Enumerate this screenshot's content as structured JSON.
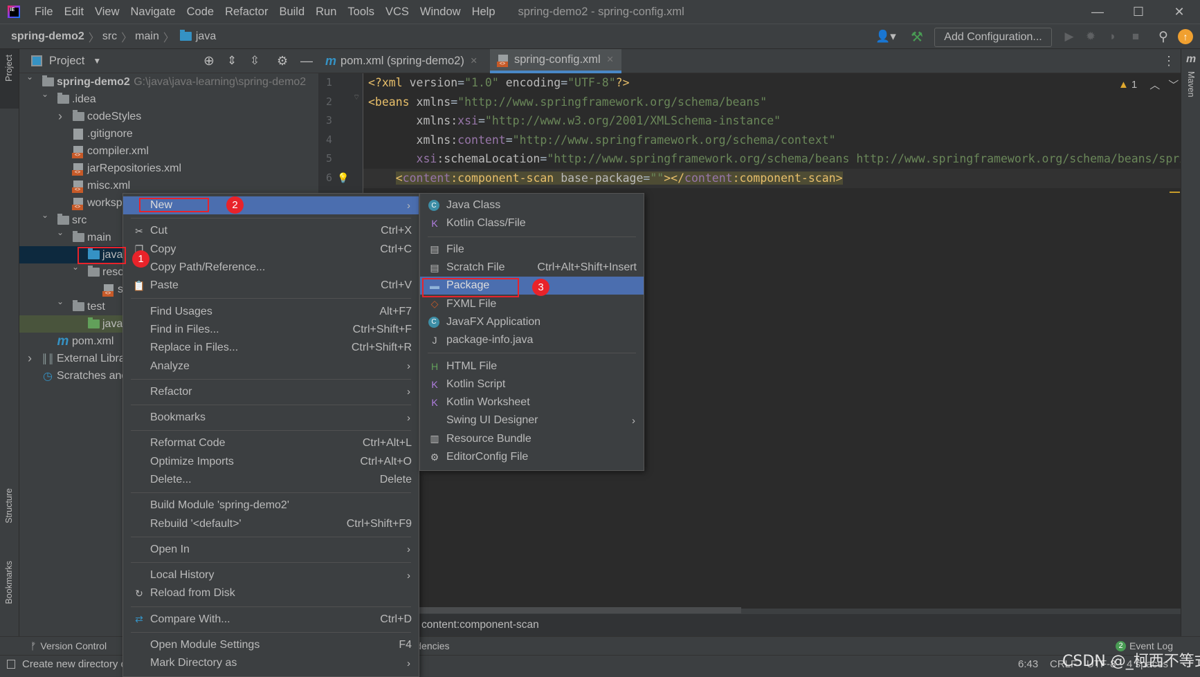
{
  "title_bar": {
    "menu": [
      "File",
      "Edit",
      "View",
      "Navigate",
      "Code",
      "Refactor",
      "Build",
      "Run",
      "Tools",
      "VCS",
      "Window",
      "Help"
    ],
    "window_title": "spring-demo2 - spring-config.xml"
  },
  "navbar": {
    "breadcrumb": [
      "spring-demo2",
      "src",
      "main",
      "java"
    ],
    "add_configuration": "Add Configuration..."
  },
  "side_strips": {
    "left_top": "Project",
    "left_structure": "Structure",
    "left_bookmarks": "Bookmarks",
    "right_maven": "Maven"
  },
  "project_panel": {
    "title": "Project",
    "tree": [
      {
        "label": "spring-demo2",
        "hint": "G:\\java\\java-learning\\spring-demo2",
        "depth": 0,
        "state": "expanded",
        "icon": "module-folder",
        "bold": true
      },
      {
        "label": ".idea",
        "depth": 1,
        "state": "expanded",
        "icon": "folder"
      },
      {
        "label": "codeStyles",
        "depth": 2,
        "state": "collapsed",
        "icon": "folder"
      },
      {
        "label": ".gitignore",
        "depth": 2,
        "icon": "ignore-file"
      },
      {
        "label": "compiler.xml",
        "depth": 2,
        "icon": "xml-file"
      },
      {
        "label": "jarRepositories.xml",
        "depth": 2,
        "icon": "xml-file"
      },
      {
        "label": "misc.xml",
        "depth": 2,
        "icon": "xml-file"
      },
      {
        "label": "workspace.xml",
        "depth": 2,
        "icon": "xml-file"
      },
      {
        "label": "src",
        "depth": 1,
        "state": "expanded",
        "icon": "folder"
      },
      {
        "label": "main",
        "depth": 2,
        "state": "expanded",
        "icon": "folder"
      },
      {
        "label": "java",
        "depth": 3,
        "icon": "source-folder",
        "selected": true
      },
      {
        "label": "resources",
        "depth": 3,
        "state": "expanded",
        "icon": "resources-folder"
      },
      {
        "label": "spring-config.xml",
        "depth": 4,
        "icon": "xml-file"
      },
      {
        "label": "test",
        "depth": 2,
        "state": "expanded",
        "icon": "folder"
      },
      {
        "label": "java",
        "depth": 3,
        "icon": "test-folder",
        "highlighted": true
      },
      {
        "label": "pom.xml",
        "depth": 1,
        "icon": "maven-file"
      },
      {
        "label": "External Libraries",
        "depth": 0,
        "state": "collapsed",
        "icon": "libraries"
      },
      {
        "label": "Scratches and Consoles",
        "depth": 0,
        "icon": "scratches"
      }
    ]
  },
  "tabs": [
    {
      "label": "pom.xml (spring-demo2)",
      "icon": "maven-icon",
      "active": false
    },
    {
      "label": "spring-config.xml",
      "icon": "xml-file-icon",
      "active": true
    }
  ],
  "editor": {
    "warnings": "1",
    "lines": [
      {
        "n": "1",
        "seg": [
          [
            "<?xml ",
            "tag"
          ],
          [
            "version",
            "attr"
          ],
          [
            "=",
            "txt"
          ],
          [
            "\"1.0\" ",
            "str"
          ],
          [
            "encoding",
            "attr"
          ],
          [
            "=",
            "txt"
          ],
          [
            "\"UTF-8\"",
            "str"
          ],
          [
            "?>",
            "tag"
          ]
        ]
      },
      {
        "n": "2",
        "seg": [
          [
            "<beans ",
            "tag"
          ],
          [
            "xmlns",
            "attr"
          ],
          [
            "=",
            "txt"
          ],
          [
            "\"http://www.springframework.org/schema/beans\"",
            "str"
          ]
        ]
      },
      {
        "n": "3",
        "seg": [
          [
            "       ",
            "txt"
          ],
          [
            "xmlns",
            "attr"
          ],
          [
            ":",
            "attr"
          ],
          [
            "xsi",
            "ns"
          ],
          [
            "=",
            "txt"
          ],
          [
            "\"http://www.w3.org/2001/XMLSchema-instance\"",
            "str"
          ]
        ]
      },
      {
        "n": "4",
        "seg": [
          [
            "       ",
            "txt"
          ],
          [
            "xmlns",
            "attr"
          ],
          [
            ":",
            "attr"
          ],
          [
            "content",
            "ns"
          ],
          [
            "=",
            "txt"
          ],
          [
            "\"http://www.springframework.org/schema/context\"",
            "str"
          ]
        ]
      },
      {
        "n": "5",
        "seg": [
          [
            "       ",
            "txt"
          ],
          [
            "xsi",
            "ns"
          ],
          [
            ":schemaLocation",
            "attr"
          ],
          [
            "=",
            "txt"
          ],
          [
            "\"http://www.springframework.org/schema/beans http://www.springframework.org/schema/beans/spring-beans.xsd\"",
            "str"
          ]
        ]
      },
      {
        "n": "6",
        "seg": [
          [
            "    ",
            "txt"
          ],
          [
            "<",
            "tag hl"
          ],
          [
            "content",
            "ns hl"
          ],
          [
            ":component-scan ",
            "tag hl"
          ],
          [
            "base-package",
            "attr hl"
          ],
          [
            "=",
            "txt hl"
          ],
          [
            "\"\"",
            "str hl"
          ],
          [
            "></",
            "tag hl"
          ],
          [
            "content",
            "ns hl"
          ],
          [
            ":component-scan>",
            "tag hl"
          ]
        ]
      }
    ],
    "breadcrumb": "content:component-scan"
  },
  "context_menu": [
    {
      "label": "New",
      "submenu": true,
      "selected": true
    },
    {
      "sep": true
    },
    {
      "label": "Cut",
      "shortcut": "Ctrl+X",
      "icon": "scissors"
    },
    {
      "label": "Copy",
      "shortcut": "Ctrl+C",
      "icon": "copy"
    },
    {
      "label": "Copy Path/Reference..."
    },
    {
      "label": "Paste",
      "shortcut": "Ctrl+V",
      "icon": "clipboard"
    },
    {
      "sep": true
    },
    {
      "label": "Find Usages",
      "shortcut": "Alt+F7"
    },
    {
      "label": "Find in Files...",
      "shortcut": "Ctrl+Shift+F"
    },
    {
      "label": "Replace in Files...",
      "shortcut": "Ctrl+Shift+R"
    },
    {
      "label": "Analyze",
      "submenu": true
    },
    {
      "sep": true
    },
    {
      "label": "Refactor",
      "submenu": true
    },
    {
      "sep": true
    },
    {
      "label": "Bookmarks",
      "submenu": true
    },
    {
      "sep": true
    },
    {
      "label": "Reformat Code",
      "shortcut": "Ctrl+Alt+L"
    },
    {
      "label": "Optimize Imports",
      "shortcut": "Ctrl+Alt+O"
    },
    {
      "label": "Delete...",
      "shortcut": "Delete"
    },
    {
      "sep": true
    },
    {
      "label": "Build Module 'spring-demo2'"
    },
    {
      "label": "Rebuild '<default>'",
      "shortcut": "Ctrl+Shift+F9"
    },
    {
      "sep": true
    },
    {
      "label": "Open In",
      "submenu": true
    },
    {
      "sep": true
    },
    {
      "label": "Local History",
      "submenu": true
    },
    {
      "label": "Reload from Disk",
      "icon": "reload"
    },
    {
      "sep": true
    },
    {
      "label": "Compare With...",
      "shortcut": "Ctrl+D",
      "icon": "compare"
    },
    {
      "sep": true
    },
    {
      "label": "Open Module Settings",
      "shortcut": "F4"
    },
    {
      "label": "Mark Directory as",
      "submenu": true
    }
  ],
  "new_submenu": [
    {
      "label": "Java Class",
      "icon": "java-class"
    },
    {
      "label": "Kotlin Class/File",
      "icon": "kotlin-file"
    },
    {
      "sep": true
    },
    {
      "label": "File",
      "icon": "file"
    },
    {
      "label": "Scratch File",
      "shortcut": "Ctrl+Alt+Shift+Insert",
      "icon": "scratch-file"
    },
    {
      "label": "Package",
      "icon": "package",
      "selected": true
    },
    {
      "label": "FXML File",
      "icon": "fxml-file"
    },
    {
      "label": "JavaFX Application",
      "icon": "java-class"
    },
    {
      "label": "package-info.java",
      "icon": "java-file"
    },
    {
      "sep": true
    },
    {
      "label": "HTML File",
      "icon": "html-file"
    },
    {
      "label": "Kotlin Script",
      "icon": "kotlin-script"
    },
    {
      "label": "Kotlin Worksheet",
      "icon": "kotlin-script"
    },
    {
      "label": "Swing UI Designer",
      "submenu": true
    },
    {
      "label": "Resource Bundle",
      "icon": "resource-bundle"
    },
    {
      "label": "EditorConfig File",
      "icon": "gear"
    }
  ],
  "annotations": {
    "step1": "1",
    "step2": "2",
    "step3": "3",
    "highlight_color": "#e8232a"
  },
  "bottom": {
    "version_control": "Version Control",
    "dependencies_tab": "Dependencies",
    "event_log": "Event Log",
    "event_count": "2",
    "status_message": "Create new directory or package",
    "caret": "6:43",
    "line_sep": "CRLF",
    "encoding": "UTF-8",
    "indent": "4 spaces"
  },
  "watermark": "CSDN @_柯西不等式",
  "colors": {
    "accent": "#4b6eaf",
    "selection": "#0d293e",
    "editor_bg": "#2b2b2b",
    "panel_bg": "#3c3f41"
  }
}
